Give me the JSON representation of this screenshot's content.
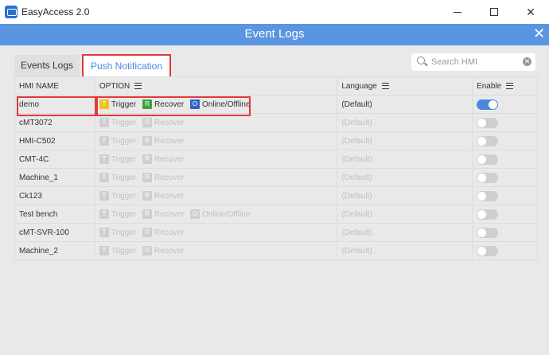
{
  "window": {
    "title": "EasyAccess 2.0"
  },
  "header": {
    "title": "Event Logs",
    "close": "✕"
  },
  "tabs": [
    {
      "label": "Events Logs",
      "active": false
    },
    {
      "label": "Push Notification",
      "active": true
    }
  ],
  "search": {
    "placeholder": "Search HMI",
    "value": ""
  },
  "columns": {
    "name": "HMI NAME",
    "option": "OPTION",
    "language": "Language",
    "enable": "Enable"
  },
  "options": {
    "trigger_badge": "T",
    "trigger": "Trigger",
    "recover_badge": "R",
    "recover": "Recover",
    "online_badge": "O",
    "online": "Online/Offline"
  },
  "rows": [
    {
      "name": "demo",
      "language": "(Default)",
      "enabled": true
    },
    {
      "name": "cMT3072",
      "language": "(Default)",
      "enabled": false
    },
    {
      "name": "HMI-C502",
      "language": "(Default)",
      "enabled": false
    },
    {
      "name": "CMT-4C",
      "language": "(Default)",
      "enabled": false
    },
    {
      "name": "Machine_1",
      "language": "(Default)",
      "enabled": false
    },
    {
      "name": "Ck123",
      "language": "(Default)",
      "enabled": false
    },
    {
      "name": "Test bench",
      "language": "(Default)",
      "enabled": false
    },
    {
      "name": "cMT-SVR-100",
      "language": "(Default)",
      "enabled": false
    },
    {
      "name": "Machine_2",
      "language": "(Default)",
      "enabled": false
    }
  ],
  "colors": {
    "accent": "#4a88d8",
    "header": "#5a95e1",
    "highlight": "#e03a3a"
  }
}
